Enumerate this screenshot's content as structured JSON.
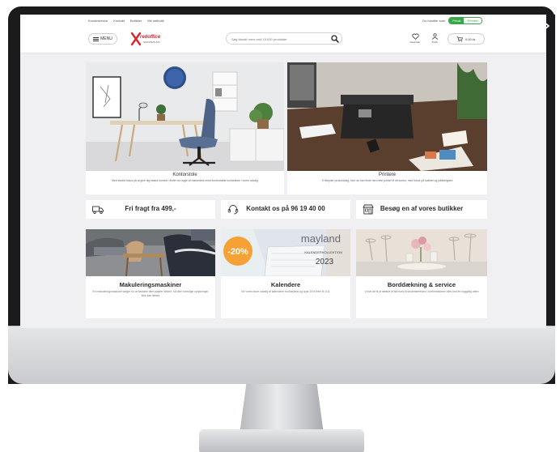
{
  "utility_bar": {
    "links": [
      "Kundeservice",
      "Kontakt",
      "Butikker",
      "Mit netbutik"
    ],
    "account_type_label": "Du handler som",
    "account_options": [
      {
        "label": "Privat",
        "active": true
      },
      {
        "label": "Erhverv",
        "active": false
      }
    ]
  },
  "header": {
    "menu_label": "MENU",
    "logo_name": "redoffice",
    "logo_sub": "SKOVHUS A/S",
    "search_placeholder": "Søg blandt mere end 15.000 produkter",
    "favorites_label": "Favoritter",
    "login_label": "Profil",
    "cart_total": "0,00 kr."
  },
  "hero_cards": [
    {
      "title": "Kontorstole",
      "desc": "Med ekstra fokus på at give dig ekstra komfort, finder du nogle af markedets mest komfortable kontorstole i vores udvalg"
    },
    {
      "title": "Printere",
      "desc": "Vi tilbyder produktvalg, hvor du kan finde den rette printer til dit kontor, med fokus på kvalitet og pålidelighed"
    }
  ],
  "info_strip": [
    {
      "label": "Fri fragt fra 499,-",
      "icon": "truck-icon"
    },
    {
      "label": "Kontakt os på 96 19 40 00",
      "icon": "headset-icon"
    },
    {
      "label": "Besøg en af vores butikker",
      "icon": "store-icon"
    }
  ],
  "product_cards": [
    {
      "title": "Makuleringsmaskiner",
      "desc": "En makuleringsmaskine sørger for at kassere dine papirer sikkert, så dine fortrolige oplysninger ikke kan læses"
    },
    {
      "title": "Kalendere",
      "desc": "Se vores store udvalg af kalendere fra Mayland og spar 20% frem til 1/11",
      "badge": "-20%",
      "brand": "mayland",
      "brand_sub": "KALENDERKOLLEKTION",
      "year": "2023"
    },
    {
      "title": "Borddækning & service",
      "desc": "Vi har alt til at dække et flot bord til studenterfesten, konfirmationen eller blot en hyggelig aften"
    }
  ],
  "colors": {
    "brand_red": "#d6262e",
    "accent_green": "#3aa64c",
    "badge_orange": "#f6a135"
  }
}
